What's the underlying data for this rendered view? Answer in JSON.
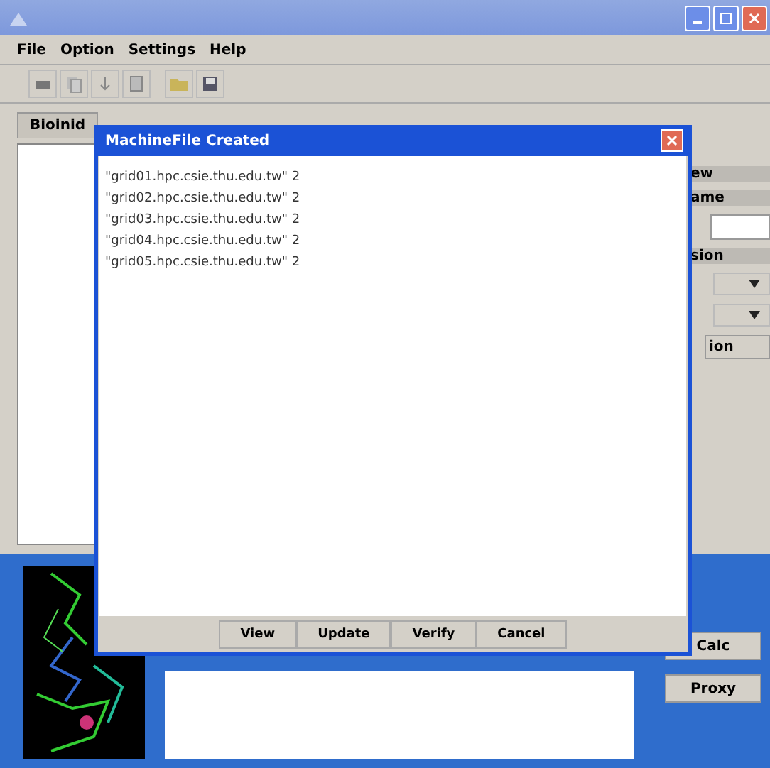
{
  "menu": [
    "File",
    "Option",
    "Settings",
    "Help"
  ],
  "tabs": [
    {
      "label": "Bioinid"
    }
  ],
  "side_labels": [
    "ew",
    "ame",
    "sion",
    "ion"
  ],
  "bottom_buttons": [
    "Calc",
    "Proxy"
  ],
  "dialog": {
    "title": "MachineFile Created",
    "lines": [
      "\"grid01.hpc.csie.thu.edu.tw\" 2",
      "\"grid02.hpc.csie.thu.edu.tw\" 2",
      "\"grid03.hpc.csie.thu.edu.tw\" 2",
      "\"grid04.hpc.csie.thu.edu.tw\" 2",
      "\"grid05.hpc.csie.thu.edu.tw\" 2"
    ],
    "buttons": [
      "View",
      "Update",
      "Verify",
      "Cancel"
    ]
  }
}
